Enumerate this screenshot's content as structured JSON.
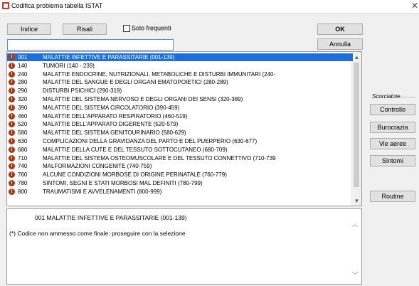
{
  "window": {
    "title": "Codifica problema tabella ISTAT"
  },
  "toolbar": {
    "indice_label": "Indice",
    "risali_label": "Risali",
    "solo_frequenti_label": "Solo frequenti",
    "solo_frequenti_checked": false,
    "ok_label": "OK",
    "annulla_label": "Annulla"
  },
  "search": {
    "value": "",
    "placeholder": ""
  },
  "list": {
    "items": [
      {
        "code": "001",
        "description": "MALATTIE INFETTIVE E PARASSITARIE (001-139)",
        "selected": true
      },
      {
        "code": "140",
        "description": "TUMORI (140 - 239)"
      },
      {
        "code": "240",
        "description": "MALATTIE ENDOCRINE, NUTRIZIONALI, METABOLICHE E DISTURBI IMMUNITARI (240-"
      },
      {
        "code": "280",
        "description": "MALATTIE DEL SANGUE E DEGLI ORGANI EMATOPOIETICI (280-289)"
      },
      {
        "code": "290",
        "description": "DISTURBI PSICHICI (290-319)"
      },
      {
        "code": "320",
        "description": "MALATTIE DEL SISTEMA NERVOSO E DEGLI ORGANI DEI SENSI (320-389)"
      },
      {
        "code": "390",
        "description": "MALATTIE DEL SISTEMA CIRCOLATORIO (390-459)"
      },
      {
        "code": "460",
        "description": "MALATTIE DELL'APPARATO RESPIRATORIO (460-519)"
      },
      {
        "code": "520",
        "description": "MALATTIE DELL'APPARATO DIGERENTE (520-579)"
      },
      {
        "code": "580",
        "description": "MALATTIE DEL SISTEMA GENITOURINARIO (580-629)"
      },
      {
        "code": "630",
        "description": "COMPLICAZIONI DELLA GRAVIDANZA DEL PARTO E DEL PUERPERIO (630-677)"
      },
      {
        "code": "680",
        "description": "MALATTIE DELLA CUTE E DEL TESSUTO SOTTOCUTANEO (680-709)"
      },
      {
        "code": "710",
        "description": "MALATTIE DEL SISTEMA OSTEOMUSCOLARE E DEL TESSUTO CONNETTIVO (710-739"
      },
      {
        "code": "740",
        "description": "MALFORMAZIONI CONGENITE (740-759)"
      },
      {
        "code": "760",
        "description": "ALCUNE CONDIZIONI MORBOSE DI ORIGINE PERINATALE (760-779)"
      },
      {
        "code": "780",
        "description": "SINTOMI, SEGNI E STATI MORBOSI MAL DEFINITI (780-799)"
      },
      {
        "code": "800",
        "description": "TRAUMATISMI E AVVELENAMENTI (800-999)"
      }
    ],
    "item_icon": "exclamation-icon"
  },
  "detail": {
    "line1": "001  MALATTIE INFETTIVE E PARASSITARIE (001-139)",
    "line2": "(*) Codice non ammesso come finale: proseguire con la selezione"
  },
  "shortcuts": {
    "group_label": "Scorciatoie",
    "buttons": [
      "Controllo",
      "Burocrazia",
      "Vie aeree",
      "Sintomi"
    ],
    "routine_label": "Routine"
  },
  "colors": {
    "selection": "#1e6fd9",
    "item_icon": "#b3360b",
    "app_icon": "#c0392b"
  }
}
